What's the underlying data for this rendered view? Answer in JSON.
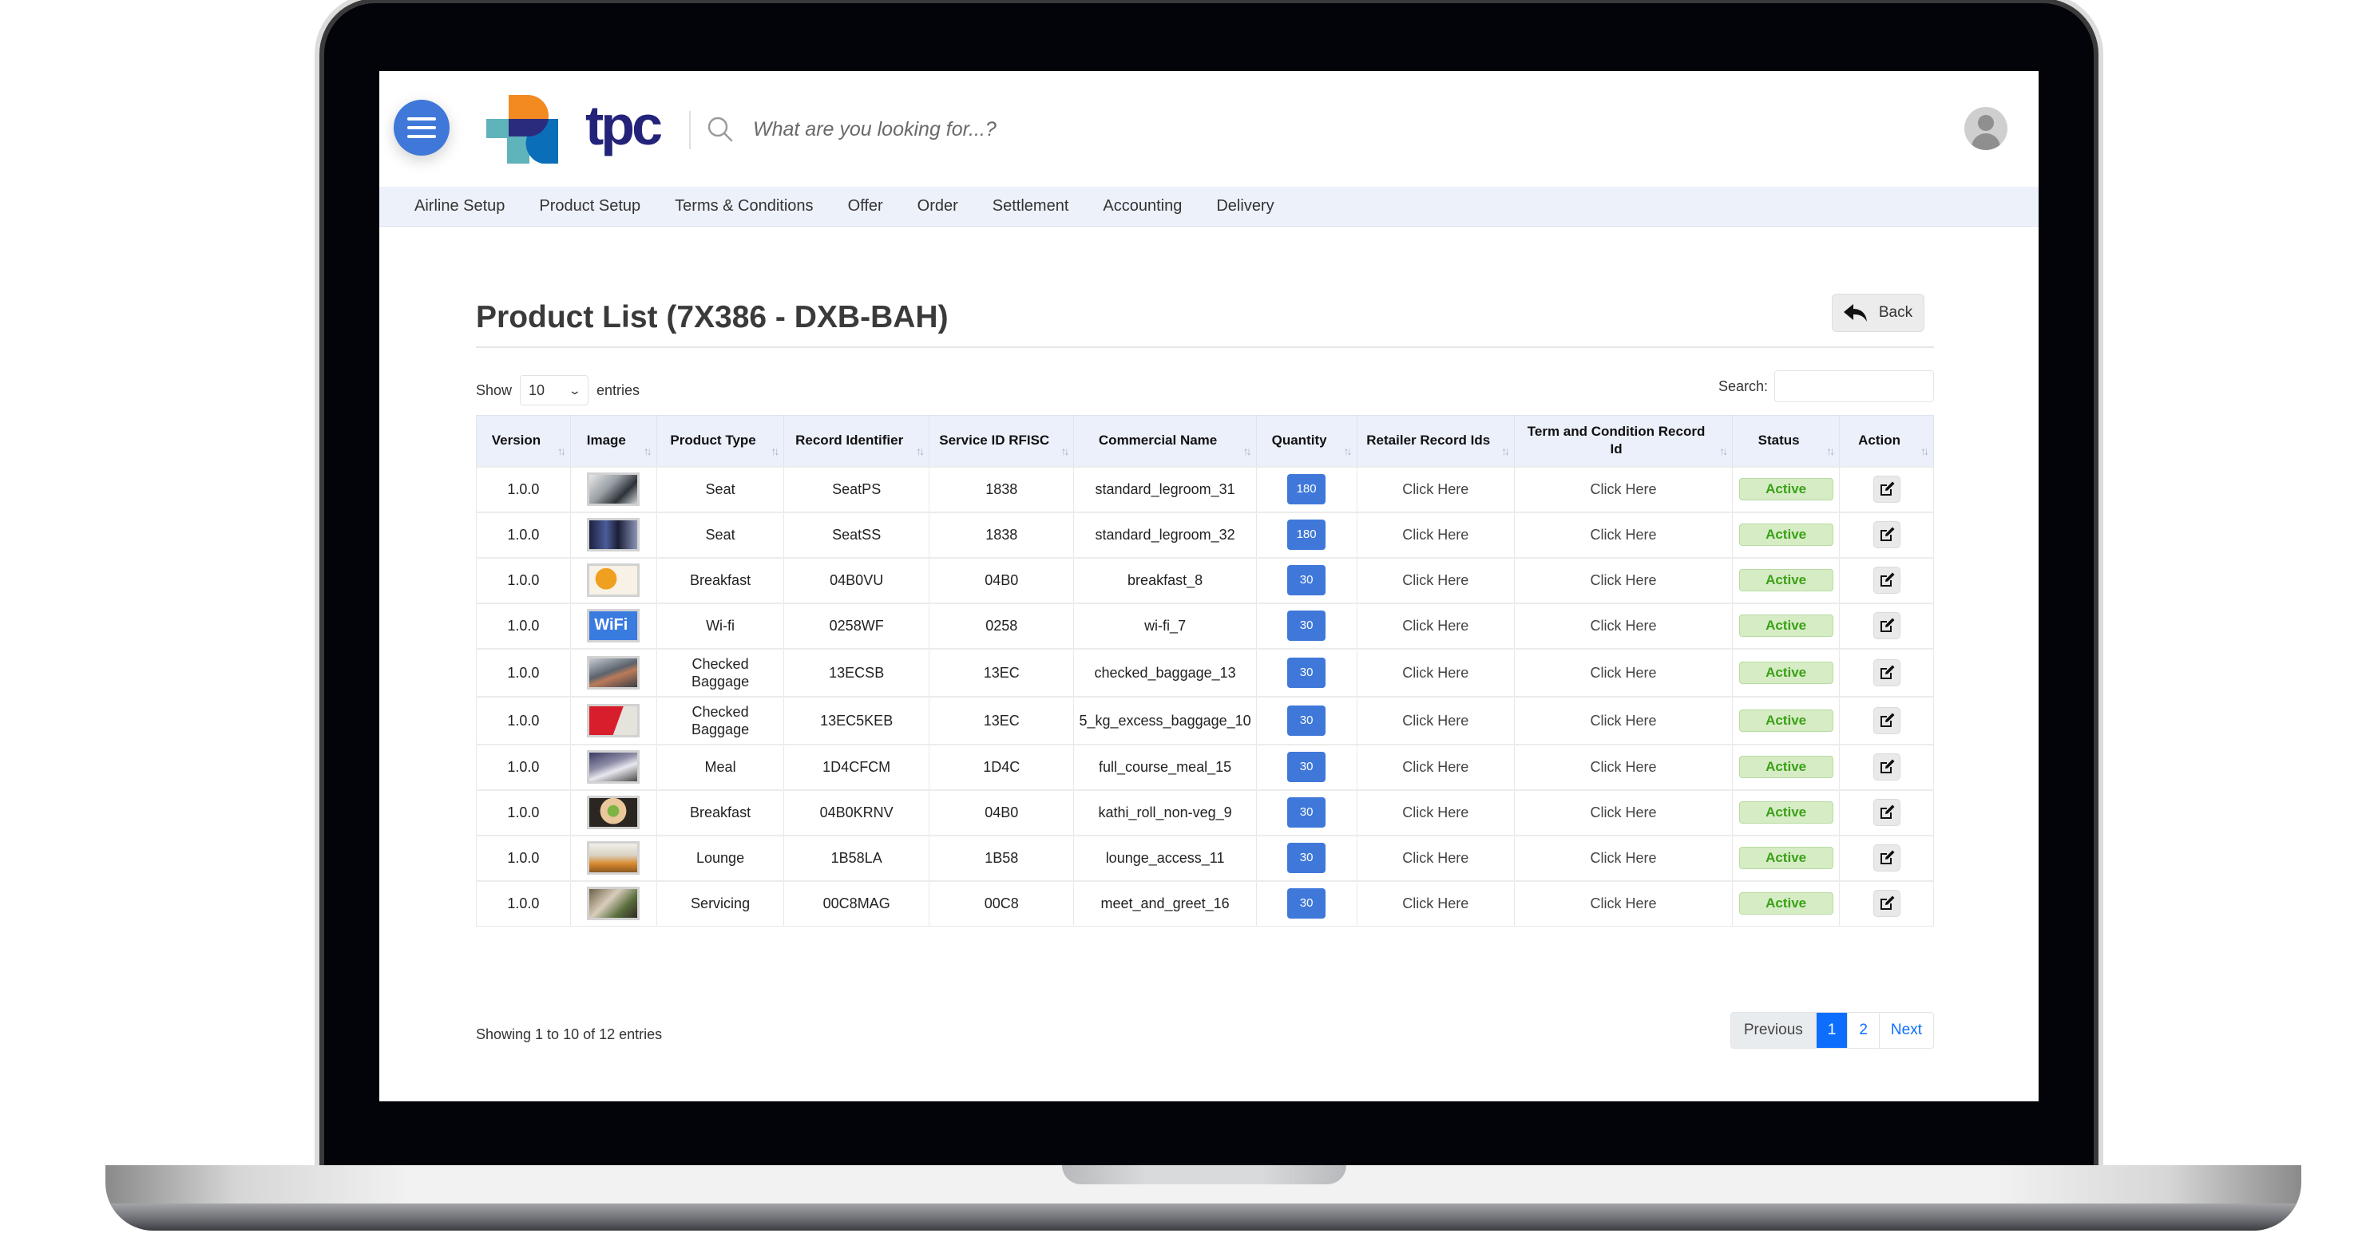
{
  "header": {
    "logo_text": "tpc",
    "search_placeholder": "What are you looking for...?"
  },
  "nav": {
    "items": [
      {
        "label": "Airline Setup"
      },
      {
        "label": "Product Setup"
      },
      {
        "label": "Terms & Conditions"
      },
      {
        "label": "Offer"
      },
      {
        "label": "Order"
      },
      {
        "label": "Settlement"
      },
      {
        "label": "Accounting"
      },
      {
        "label": "Delivery"
      }
    ]
  },
  "page": {
    "title": "Product List (7X386 - DXB-BAH)",
    "back_label": "Back"
  },
  "table_controls": {
    "show_label": "Show",
    "page_length": "10",
    "entries_label": "entries",
    "search_label": "Search:",
    "search_value": ""
  },
  "table": {
    "columns": [
      {
        "label": "Version"
      },
      {
        "label": "Image"
      },
      {
        "label": "Product Type"
      },
      {
        "label": "Record Identifier"
      },
      {
        "label": "Service ID RFISC"
      },
      {
        "label": "Commercial Name"
      },
      {
        "label": "Quantity"
      },
      {
        "label": "Retailer Record Ids"
      },
      {
        "label": "Term and Condition Record Id"
      },
      {
        "label": "Status"
      },
      {
        "label": "Action"
      }
    ],
    "sort_icon": "sort-arrows-icon",
    "rows": [
      {
        "version": "1.0.0",
        "image": "seat-cabin-thumbnail",
        "product_type": "Seat",
        "record_identifier": "SeatPS",
        "rfisc": "1838",
        "commercial_name": "standard_legroom_31",
        "quantity": "180",
        "retailer_ids": "Click Here",
        "tc_record_id": "Click Here",
        "status": "Active"
      },
      {
        "version": "1.0.0",
        "image": "seat-rows-thumbnail",
        "product_type": "Seat",
        "record_identifier": "SeatSS",
        "rfisc": "1838",
        "commercial_name": "standard_legroom_32",
        "quantity": "180",
        "retailer_ids": "Click Here",
        "tc_record_id": "Click Here",
        "status": "Active"
      },
      {
        "version": "1.0.0",
        "image": "breakfast-tray-thumbnail",
        "product_type": "Breakfast",
        "record_identifier": "04B0VU",
        "rfisc": "04B0",
        "commercial_name": "breakfast_8",
        "quantity": "30",
        "retailer_ids": "Click Here",
        "tc_record_id": "Click Here",
        "status": "Active"
      },
      {
        "version": "1.0.0",
        "image": "wifi-thumbnail",
        "product_type": "Wi-fi",
        "record_identifier": "0258WF",
        "rfisc": "0258",
        "commercial_name": "wi-fi_7",
        "quantity": "30",
        "retailer_ids": "Click Here",
        "tc_record_id": "Click Here",
        "status": "Active"
      },
      {
        "version": "1.0.0",
        "image": "baggage-hall-thumbnail",
        "product_type": "Checked Baggage",
        "record_identifier": "13ECSB",
        "rfisc": "13EC",
        "commercial_name": "checked_baggage_13",
        "quantity": "30",
        "retailer_ids": "Click Here",
        "tc_record_id": "Click Here",
        "status": "Active"
      },
      {
        "version": "1.0.0",
        "image": "overweight-baggage-thumbnail",
        "product_type": "Checked Baggage",
        "record_identifier": "13EC5KEB",
        "rfisc": "13EC",
        "commercial_name": "5_kg_excess_baggage_10",
        "quantity": "30",
        "retailer_ids": "Click Here",
        "tc_record_id": "Click Here",
        "status": "Active"
      },
      {
        "version": "1.0.0",
        "image": "meal-service-thumbnail",
        "product_type": "Meal",
        "record_identifier": "1D4CFCM",
        "rfisc": "1D4C",
        "commercial_name": "full_course_meal_15",
        "quantity": "30",
        "retailer_ids": "Click Here",
        "tc_record_id": "Click Here",
        "status": "Active"
      },
      {
        "version": "1.0.0",
        "image": "kathi-roll-thumbnail",
        "product_type": "Breakfast",
        "record_identifier": "04B0KRNV",
        "rfisc": "04B0",
        "commercial_name": "kathi_roll_non-veg_9",
        "quantity": "30",
        "retailer_ids": "Click Here",
        "tc_record_id": "Click Here",
        "status": "Active"
      },
      {
        "version": "1.0.0",
        "image": "lounge-thumbnail",
        "product_type": "Lounge",
        "record_identifier": "1B58LA",
        "rfisc": "1B58",
        "commercial_name": "lounge_access_11",
        "quantity": "30",
        "retailer_ids": "Click Here",
        "tc_record_id": "Click Here",
        "status": "Active"
      },
      {
        "version": "1.0.0",
        "image": "meet-greet-thumbnail",
        "product_type": "Servicing",
        "record_identifier": "00C8MAG",
        "rfisc": "00C8",
        "commercial_name": "meet_and_greet_16",
        "quantity": "30",
        "retailer_ids": "Click Here",
        "tc_record_id": "Click Here",
        "status": "Active"
      }
    ]
  },
  "footer": {
    "info": "Showing 1 to 10 of 12 entries",
    "pagination": {
      "previous": "Previous",
      "pages": [
        "1",
        "2"
      ],
      "current": "1",
      "next": "Next"
    }
  },
  "colors": {
    "primary": "#3f78d9",
    "pagination_active": "#0d6efd",
    "status_active_bg": "#d6ecc5",
    "status_active_text": "#3aa117",
    "nav_bg": "#edf1fa",
    "table_header_bg": "#ebf0fb",
    "brand_navy": "#24237a",
    "brand_orange": "#f28a21",
    "brand_teal": "#5fb3ba",
    "brand_blue": "#0a6fb8"
  }
}
